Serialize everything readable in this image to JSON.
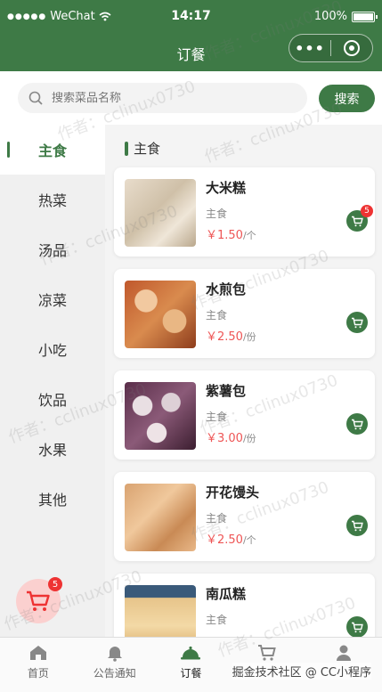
{
  "status": {
    "carrier": "WeChat",
    "time": "14:17",
    "battery": "100%"
  },
  "navbar": {
    "title": "订餐",
    "capsule_more": "•••"
  },
  "search": {
    "placeholder": "搜索菜品名称",
    "button": "搜索"
  },
  "sidebar": {
    "items": [
      {
        "label": "主食"
      },
      {
        "label": "热菜"
      },
      {
        "label": "汤品"
      },
      {
        "label": "凉菜"
      },
      {
        "label": "小吃"
      },
      {
        "label": "饮品"
      },
      {
        "label": "水果"
      },
      {
        "label": "其他"
      }
    ]
  },
  "section": {
    "title": "主食"
  },
  "dishes": [
    {
      "name": "大米糕",
      "category": "主食",
      "price": "￥1.50",
      "unit": "/个",
      "badge": "5"
    },
    {
      "name": "水煎包",
      "category": "主食",
      "price": "￥2.50",
      "unit": "/份"
    },
    {
      "name": "紫薯包",
      "category": "主食",
      "price": "￥3.00",
      "unit": "/份"
    },
    {
      "name": "开花馒头",
      "category": "主食",
      "price": "￥2.50",
      "unit": "/个"
    },
    {
      "name": "南瓜糕",
      "category": "主食"
    }
  ],
  "float_cart": {
    "badge": "5"
  },
  "tabbar": {
    "items": [
      {
        "label": "首页"
      },
      {
        "label": "公告通知"
      },
      {
        "label": "订餐"
      },
      {
        "label": ""
      },
      {
        "label": ""
      }
    ]
  },
  "watermark": {
    "text": "作者：cclinux0730"
  },
  "footer": {
    "text": "掘金技术社区 @ CC小程序"
  },
  "colors": {
    "primary": "#3e7a46",
    "price": "#e55555",
    "badge": "#e33333"
  }
}
